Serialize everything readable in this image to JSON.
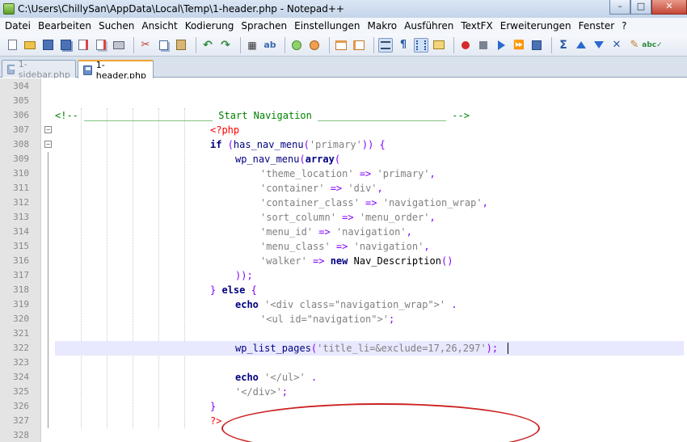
{
  "window": {
    "title": "C:\\Users\\ChillySan\\AppData\\Local\\Temp\\1-header.php - Notepad++"
  },
  "menu": [
    "Datei",
    "Bearbeiten",
    "Suchen",
    "Ansicht",
    "Kodierung",
    "Sprachen",
    "Einstellungen",
    "Makro",
    "Ausführen",
    "TextFX",
    "Erweiterungen",
    "Fenster",
    "?"
  ],
  "tabs": [
    {
      "label": "1-sidebar.php",
      "active": false
    },
    {
      "label": "1-header.php",
      "active": true
    }
  ],
  "editor": {
    "current_line": 322,
    "lines": [
      {
        "n": "304",
        "segs": []
      },
      {
        "n": "305",
        "segs": []
      },
      {
        "n": "306",
        "segs": [
          {
            "t": "<!-- ______________________ Start Navigation ______________________ -->",
            "c": "c-comment"
          }
        ]
      },
      {
        "n": "307",
        "indent": 0,
        "segs": [
          {
            "t": "<?php",
            "c": "c-php"
          }
        ]
      },
      {
        "n": "308",
        "indent": 0,
        "segs": [
          {
            "t": "if",
            "c": "c-kw"
          },
          {
            "t": " (",
            "c": "c-op"
          },
          {
            "t": "has_nav_menu",
            "c": "c-fn"
          },
          {
            "t": "(",
            "c": "c-op"
          },
          {
            "t": "'primary'",
            "c": "c-str"
          },
          {
            "t": ")) {",
            "c": "c-op"
          }
        ]
      },
      {
        "n": "309",
        "indent": 1,
        "segs": [
          {
            "t": "wp_nav_menu",
            "c": "c-fn"
          },
          {
            "t": "(",
            "c": "c-op"
          },
          {
            "t": "array",
            "c": "c-kw"
          },
          {
            "t": "(",
            "c": "c-op"
          }
        ]
      },
      {
        "n": "310",
        "indent": 2,
        "segs": [
          {
            "t": "'theme_location'",
            "c": "c-str"
          },
          {
            "t": " => ",
            "c": "c-op"
          },
          {
            "t": "'primary'",
            "c": "c-str"
          },
          {
            "t": ",",
            "c": "c-op"
          }
        ]
      },
      {
        "n": "311",
        "indent": 2,
        "segs": [
          {
            "t": "'container'",
            "c": "c-str"
          },
          {
            "t": " => ",
            "c": "c-op"
          },
          {
            "t": "'div'",
            "c": "c-str"
          },
          {
            "t": ",",
            "c": "c-op"
          }
        ]
      },
      {
        "n": "312",
        "indent": 2,
        "segs": [
          {
            "t": "'container_class'",
            "c": "c-str"
          },
          {
            "t": " => ",
            "c": "c-op"
          },
          {
            "t": "'navigation_wrap'",
            "c": "c-str"
          },
          {
            "t": ",",
            "c": "c-op"
          }
        ]
      },
      {
        "n": "313",
        "indent": 2,
        "segs": [
          {
            "t": "'sort_column'",
            "c": "c-str"
          },
          {
            "t": " => ",
            "c": "c-op"
          },
          {
            "t": "'menu_order'",
            "c": "c-str"
          },
          {
            "t": ",",
            "c": "c-op"
          }
        ]
      },
      {
        "n": "314",
        "indent": 2,
        "segs": [
          {
            "t": "'menu_id'",
            "c": "c-str"
          },
          {
            "t": " => ",
            "c": "c-op"
          },
          {
            "t": "'navigation'",
            "c": "c-str"
          },
          {
            "t": ",",
            "c": "c-op"
          }
        ]
      },
      {
        "n": "315",
        "indent": 2,
        "segs": [
          {
            "t": "'menu_class'",
            "c": "c-str"
          },
          {
            "t": " => ",
            "c": "c-op"
          },
          {
            "t": "'navigation'",
            "c": "c-str"
          },
          {
            "t": ",",
            "c": "c-op"
          }
        ]
      },
      {
        "n": "316",
        "indent": 2,
        "segs": [
          {
            "t": "'walker'",
            "c": "c-str"
          },
          {
            "t": " => ",
            "c": "c-op"
          },
          {
            "t": "new",
            "c": "c-kw"
          },
          {
            "t": " Nav_Description",
            "c": "c-plain"
          },
          {
            "t": "()",
            "c": "c-op"
          }
        ]
      },
      {
        "n": "317",
        "indent": 1,
        "segs": [
          {
            "t": "));",
            "c": "c-op"
          }
        ]
      },
      {
        "n": "318",
        "indent": 0,
        "segs": [
          {
            "t": "} ",
            "c": "c-op"
          },
          {
            "t": "else",
            "c": "c-kw"
          },
          {
            "t": " {",
            "c": "c-op"
          }
        ]
      },
      {
        "n": "319",
        "indent": 1,
        "segs": [
          {
            "t": "echo",
            "c": "c-kw"
          },
          {
            "t": " ",
            "c": "c-plain"
          },
          {
            "t": "'<div class=\"navigation_wrap\">'",
            "c": "c-str"
          },
          {
            "t": " .",
            "c": "c-op"
          }
        ]
      },
      {
        "n": "320",
        "indent": 2,
        "segs": [
          {
            "t": "'<ul id=\"navigation\">'",
            "c": "c-str"
          },
          {
            "t": ";",
            "c": "c-op"
          }
        ]
      },
      {
        "n": "321",
        "segs": []
      },
      {
        "n": "322",
        "indent": 1,
        "segs": [
          {
            "t": "wp_list_pages",
            "c": "c-fn"
          },
          {
            "t": "(",
            "c": "c-op"
          },
          {
            "t": "'title_li=&exclude=17,26,297'",
            "c": "c-str"
          },
          {
            "t": ");",
            "c": "c-op"
          }
        ]
      },
      {
        "n": "323",
        "segs": []
      },
      {
        "n": "324",
        "indent": 1,
        "segs": [
          {
            "t": "echo",
            "c": "c-kw"
          },
          {
            "t": " ",
            "c": "c-plain"
          },
          {
            "t": "'</ul>'",
            "c": "c-str"
          },
          {
            "t": " .",
            "c": "c-op"
          }
        ]
      },
      {
        "n": "325",
        "indent": 1,
        "segs": [
          {
            "t": "'</div>'",
            "c": "c-str"
          },
          {
            "t": ";",
            "c": "c-op"
          }
        ]
      },
      {
        "n": "326",
        "indent": 0,
        "segs": [
          {
            "t": "}",
            "c": "c-op"
          }
        ]
      },
      {
        "n": "327",
        "indent": 0,
        "segs": [
          {
            "t": "?>",
            "c": "c-php"
          }
        ]
      },
      {
        "n": "328",
        "segs": []
      }
    ]
  },
  "icons": [
    "new-file-icon",
    "open-icon",
    "save-icon",
    "save-all-icon",
    "close-icon",
    "close-all-icon",
    "print-icon",
    "cut-icon",
    "copy-icon",
    "paste-icon",
    "undo-icon",
    "redo-icon",
    "find-icon",
    "replace-icon",
    "zoom-in-icon",
    "zoom-out-icon",
    "sync-v-icon",
    "sync-h-icon",
    "word-wrap-icon",
    "all-chars-icon",
    "indent-guide-icon",
    "user-lang-icon",
    "record-icon",
    "stop-icon",
    "play-icon",
    "play-multi-icon",
    "save-macro-icon",
    "sigma-icon",
    "up-icon",
    "down-icon",
    "x-icon",
    "pencil-icon",
    "spellcheck-icon"
  ]
}
